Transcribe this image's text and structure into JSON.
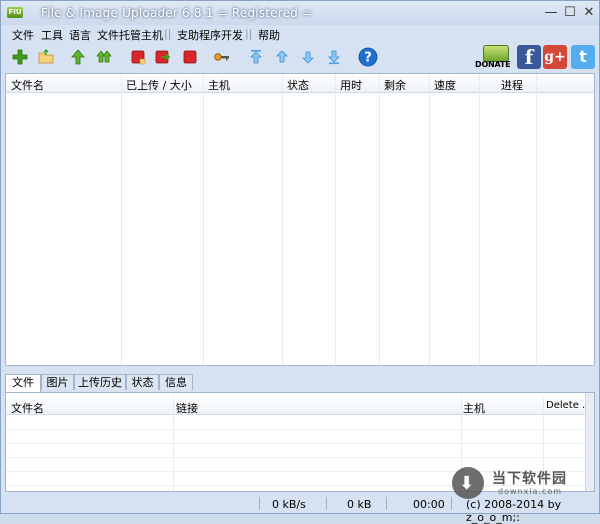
{
  "window": {
    "title": "File & Image Uploader 6.8.1  = Registered =",
    "logo_text": "FIU",
    "min_glyph": "—",
    "max_glyph": "☐",
    "close_glyph": "✕"
  },
  "menu": {
    "items": [
      "文件",
      "工具",
      "语言",
      "文件托管主机",
      "支助程序开发",
      "帮助"
    ],
    "separator": "||"
  },
  "toolbar": {
    "icons": [
      "add-icon",
      "open-folder-icon",
      "upload-icon",
      "upload-all-icon",
      "stop-icon",
      "forward-icon",
      "clear-icon",
      "key-icon",
      "move-top-icon",
      "move-up-icon",
      "move-down-icon",
      "move-bottom-icon",
      "help-icon"
    ],
    "help_glyph": "?",
    "donate_label": "DONATE",
    "facebook_glyph": "f",
    "gplus_glyph": "g+",
    "twitter_glyph": "t"
  },
  "colors": {
    "green": "#3f9c1b",
    "red": "#d9262c",
    "blue_arrow": "#4aa3e8",
    "help_blue": "#1e6fd1",
    "facebook": "#3b5998",
    "gplus": "#d34836",
    "twitter": "#55acee"
  },
  "upload_table": {
    "columns": [
      "文件名",
      "已上传 / 大小",
      "主机",
      "状态",
      "用时",
      "剩余",
      "速度",
      "进程"
    ]
  },
  "tabs": [
    "文件",
    "图片",
    "上传历史",
    "状态",
    "信息"
  ],
  "links_table": {
    "columns": [
      "文件名",
      "链接",
      "主机",
      "Delete ..."
    ]
  },
  "status": {
    "speed": "0 kB/s",
    "size": "0 kB",
    "time": "00:00",
    "copyright": "(c) 2008-2014 by z_o_o_m;:"
  },
  "watermark": {
    "text": "当下软件园",
    "sub": "downxia.com"
  }
}
